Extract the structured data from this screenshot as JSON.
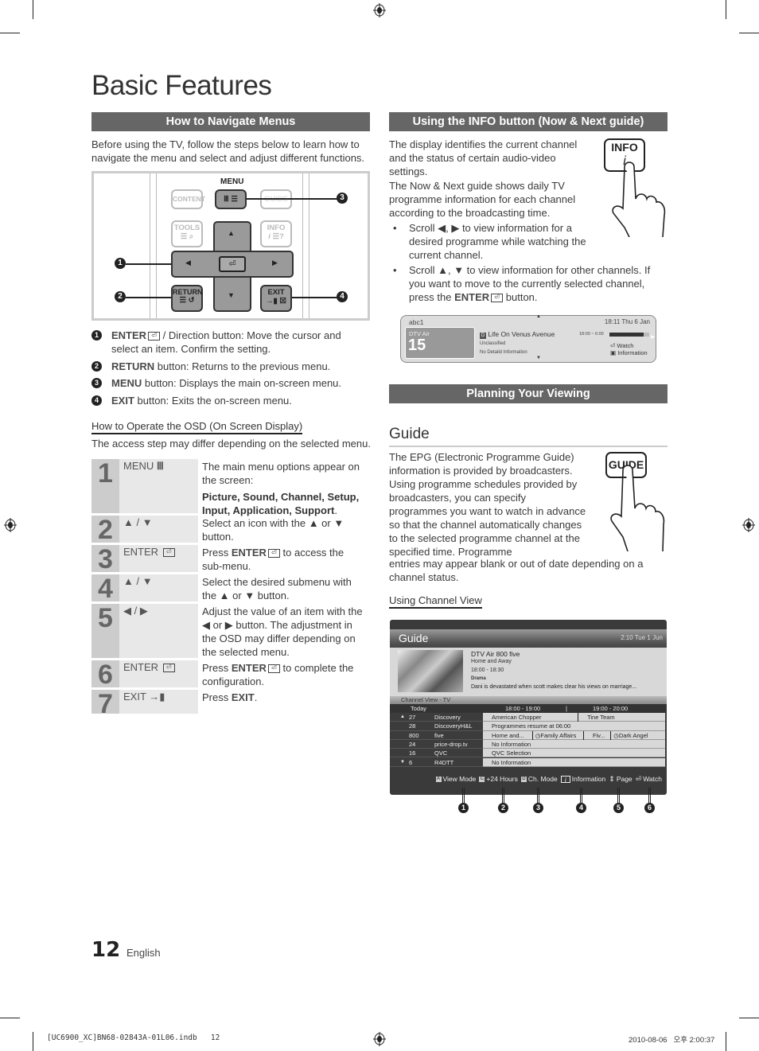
{
  "page": {
    "title": "Basic Features",
    "page_number": "12",
    "language": "English",
    "slug_left": "[UC6900_XC]BN68-02843A-01L06.indb   12",
    "slug_right": "2010-08-06   오후 2:00:37"
  },
  "navigate": {
    "header": "How to Navigate Menus",
    "intro": "Before using the TV, follow the steps below to learn how to navigate the menu and select and adjust different functions.",
    "remote": {
      "menu_label": "MENU",
      "content": "CONTENT",
      "guide": "GUIDE",
      "tools": "TOOLS",
      "info": "INFO",
      "return": "RETURN",
      "exit": "EXIT",
      "enter_glyph": "⏎",
      "up": "▲",
      "down": "▼",
      "left": "◀",
      "right": "▶",
      "callouts": [
        "1",
        "2",
        "3",
        "4"
      ]
    },
    "items": [
      {
        "num": "1",
        "key": "ENTER",
        "text": " / Direction button: Move the cursor and select an item. Confirm the setting."
      },
      {
        "num": "2",
        "key": "RETURN",
        "text": " button: Returns to the previous menu."
      },
      {
        "num": "3",
        "key": "MENU",
        "text": " button: Displays the main on-screen menu."
      },
      {
        "num": "4",
        "key": "EXIT",
        "text": " button: Exits the on-screen menu."
      }
    ]
  },
  "osd": {
    "subhead": "How to Operate the OSD (On Screen Display)",
    "note": "The access step may differ depending on the selected menu.",
    "steps": [
      {
        "num": "1",
        "key": "MENU",
        "key_icon": "Ⅲ",
        "desc": "The main menu options appear on the screen:",
        "desc_bold": "Picture, Sound, Channel, Setup, Input, Application, Support",
        "desc_tail": "."
      },
      {
        "num": "2",
        "key": "▲ / ▼",
        "desc": "Select an icon with the ▲ or ▼ button."
      },
      {
        "num": "3",
        "key": "ENTER",
        "key_icon": "⏎",
        "desc_pre": "Press ",
        "desc_key": "ENTER",
        "desc": " to access the sub-menu."
      },
      {
        "num": "4",
        "key": "▲ / ▼",
        "desc": "Select the desired submenu with the ▲ or ▼ button."
      },
      {
        "num": "5",
        "key": "◀ / ▶",
        "desc": "Adjust the value of an item with the ◀ or ▶ button. The adjustment in the OSD may differ depending on the selected menu."
      },
      {
        "num": "6",
        "key": "ENTER",
        "key_icon": "⏎",
        "desc_pre": "Press ",
        "desc_key": "ENTER",
        "desc": " to complete the configuration."
      },
      {
        "num": "7",
        "key": "EXIT",
        "key_icon": "→▮",
        "desc_pre": "Press ",
        "desc_key": "EXIT",
        "desc": "."
      }
    ]
  },
  "info_section": {
    "header": "Using the INFO button (Now & Next guide)",
    "para1": "The display identifies the current channel and the status of certain audio-video settings.",
    "para2": "The Now & Next guide shows daily TV programme information for each channel according to the broadcasting time.",
    "bullet1": "Scroll ◀, ▶ to view information for a desired programme while watching the current channel.",
    "bullet2_pre": "Scroll ▲, ▼ to view information for other channels. If you want to move to the currently selected channel, press the ",
    "bullet2_key": "ENTER",
    "bullet2_post": " button.",
    "hand_button": "INFO",
    "hand_sub": "i",
    "now_next": {
      "channel_name": "abc1",
      "clock": "18:11 Thu 6 Jan",
      "source": "DTV Air",
      "channel_num": "15",
      "programme": "Life On Venus Avenue",
      "rating": "Unclassified",
      "detail": "No Detaild Information",
      "time_range": "18:00 ~ 6:00",
      "progress": 0.85,
      "watch": "Watch",
      "information": "Information"
    }
  },
  "planning": {
    "header": "Planning Your Viewing",
    "guide_title": "Guide",
    "guide_text_narrow": "The EPG (Electronic Programme Guide) information is provided by broadcasters. Using programme schedules provided by broadcasters, you can specify programmes you want to watch in advance so that the channel automatically changes to the selected programme channel at the specified time. Programme",
    "guide_text_wide": "entries may appear blank or out of date depending on a channel status.",
    "hand_button": "GUIDE",
    "channel_view_subhead": "Using Channel View"
  },
  "epg": {
    "title": "Guide",
    "clock": "2:10 Tue 1 Jun",
    "info": {
      "channel": "DTV Air 800 five",
      "programme": "Home and Away",
      "time": "18:00 - 18:30",
      "genre": "Drama",
      "synopsis": "Dani is devastated when scott makes clear his views on marriage..."
    },
    "view_label": "Channel View - TV",
    "col_day": "Today",
    "col_slot1": "18:00 - 19:00",
    "col_slot2": "19:00 - 20:00",
    "rows": [
      {
        "arrow": "▲",
        "num": "27",
        "name": "Discovery",
        "progs": [
          "American Chopper",
          "Tine Team"
        ]
      },
      {
        "arrow": "",
        "num": "28",
        "name": "DiscoveryH&L",
        "progs": [
          "Programmes resume at 06:00"
        ]
      },
      {
        "arrow": "",
        "num": "800",
        "name": "five",
        "progs": [
          "Home and...",
          "Family Affairs",
          "Fiv...",
          "Dark Angel"
        ]
      },
      {
        "arrow": "",
        "num": "24",
        "name": "price-drop.tv",
        "progs": [
          "No Information"
        ]
      },
      {
        "arrow": "",
        "num": "16",
        "name": "QVC",
        "progs": [
          "QVC Selection"
        ]
      },
      {
        "arrow": "▼",
        "num": "6",
        "name": "R4DTT",
        "progs": [
          "No Information"
        ]
      }
    ],
    "footer": [
      {
        "key": "A",
        "label": "View Mode"
      },
      {
        "key": "C",
        "label": "+24 Hours"
      },
      {
        "key": "D",
        "label": "Ch. Mode"
      },
      {
        "key": "i",
        "label": "Information"
      },
      {
        "key": "⇕",
        "label": "Page"
      },
      {
        "key": "⏎",
        "label": "Watch"
      }
    ],
    "callouts": [
      "1",
      "2",
      "3",
      "4",
      "5",
      "6"
    ]
  }
}
